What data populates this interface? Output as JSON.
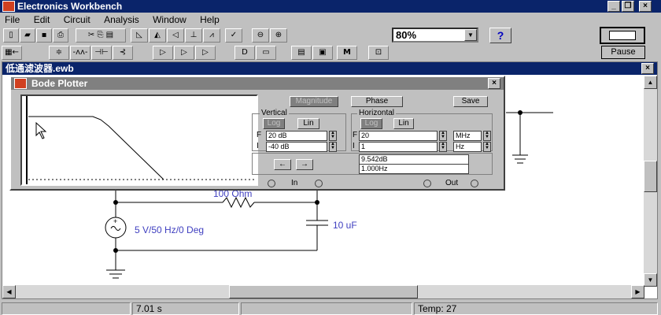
{
  "app": {
    "title": "Electronics Workbench"
  },
  "menu": [
    "File",
    "Edit",
    "Circuit",
    "Analysis",
    "Window",
    "Help"
  ],
  "toolbar": {
    "zoom_value": "80%",
    "help_label": "?",
    "pause_label": "Pause"
  },
  "document": {
    "title": "低通滤波器.ewb"
  },
  "bode": {
    "title": "Bode Plotter",
    "magnitude_label": "Magnitude",
    "phase_label": "Phase",
    "save_label": "Save",
    "vertical": {
      "label": "Vertical",
      "log": "Log",
      "lin": "Lin",
      "f_label": "F",
      "i_label": "I",
      "final": "20 dB",
      "initial": "-40 dB"
    },
    "horizontal": {
      "label": "Horizontal",
      "log": "Log",
      "lin": "Lin",
      "f_label": "F",
      "i_label": "I",
      "final": "20",
      "final_unit": "MHz",
      "initial": "1",
      "initial_unit": "Hz"
    },
    "left_arrow": "←",
    "right_arrow": "→",
    "readout_db": "9.542dB",
    "readout_hz": "1.000Hz",
    "in_label": "In",
    "out_label": "Out"
  },
  "circuit": {
    "resistor_label": "100 Ohm",
    "capacitor_label": "10 uF",
    "source_label": "5 V/50 Hz/0 Deg"
  },
  "status": {
    "time": "7.01 s",
    "temp": "Temp:  27"
  }
}
